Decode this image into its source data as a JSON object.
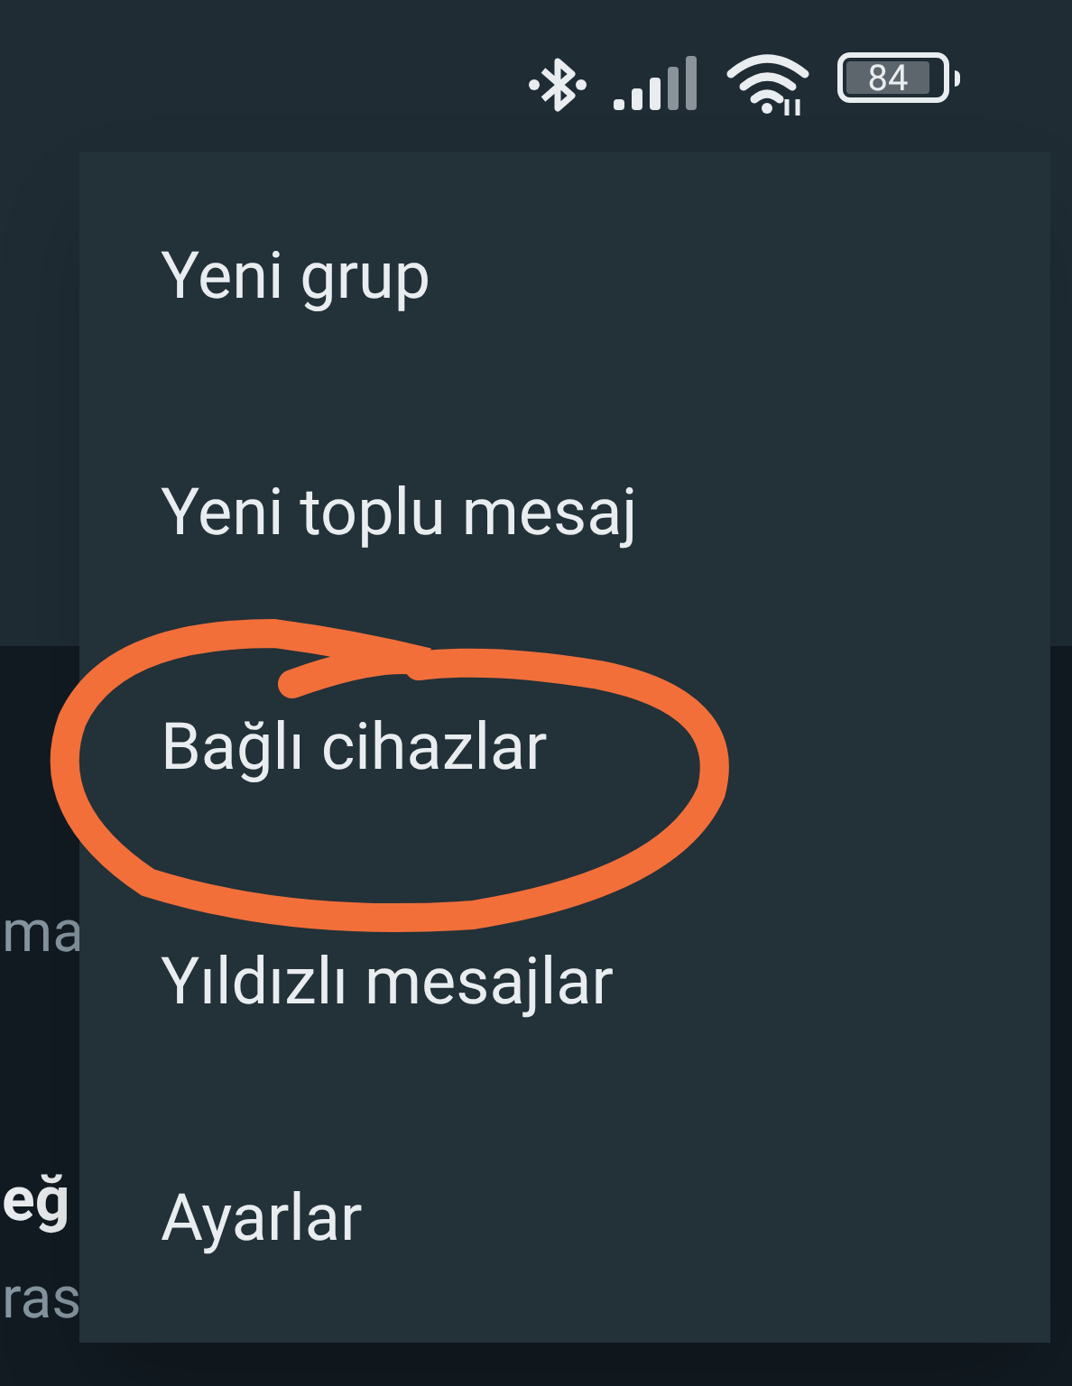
{
  "status_bar": {
    "battery": "84"
  },
  "background_list": [
    {
      "text": "ma",
      "kind": "subtitle"
    },
    {
      "text": "eğ",
      "kind": "title"
    },
    {
      "text": "ras",
      "kind": "subtitle"
    }
  ],
  "menu": {
    "items": [
      {
        "label": "Yeni grup",
        "highlighted": false
      },
      {
        "label": "Yeni toplu mesaj",
        "highlighted": false
      },
      {
        "label": "Bağlı cihazlar",
        "highlighted": true
      },
      {
        "label": "Yıldızlı mesajlar",
        "highlighted": false
      },
      {
        "label": "Ayarlar",
        "highlighted": false
      }
    ]
  }
}
